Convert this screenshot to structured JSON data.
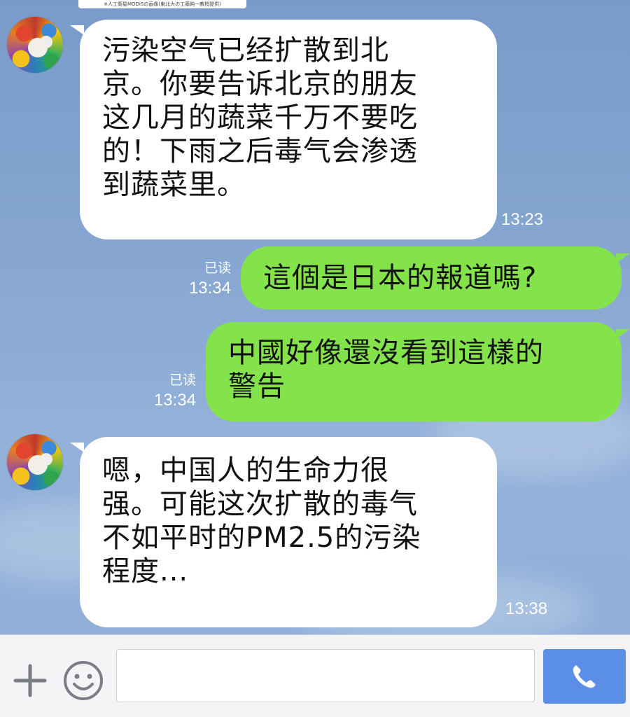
{
  "header_image_caption": "※人工衛星MODISの画像(東北大の工藤純一教授提供)",
  "messages": [
    {
      "direction": "incoming",
      "text": "污染空气已经扩散到北\n京。你要告诉北京的朋友\n这几月的蔬菜千万不要吃\n的！下雨之后毒气会渗透\n到蔬菜里。",
      "time": "13:23"
    },
    {
      "direction": "outgoing",
      "text": "這個是日本的報道嗎?",
      "time": "13:34",
      "read_label": "已读"
    },
    {
      "direction": "outgoing",
      "text": "中國好像還沒看到這樣的\n警告",
      "time": "13:34",
      "read_label": "已读"
    },
    {
      "direction": "incoming",
      "text": "嗯，中国人的生命力很\n强。可能这次扩散的毒气\n不如平时的PM2.5的污染\n程度...",
      "time": "13:38"
    }
  ],
  "input_bar": {
    "plus_icon": "plus-icon",
    "emoji_icon": "smiley-icon",
    "message_input_placeholder": "",
    "message_input_value": "",
    "call_icon": "phone-icon"
  },
  "colors": {
    "incoming_bubble": "#ffffff",
    "outgoing_bubble": "#84e34b",
    "call_button": "#5b8ee6",
    "background": "#86a6d1"
  }
}
